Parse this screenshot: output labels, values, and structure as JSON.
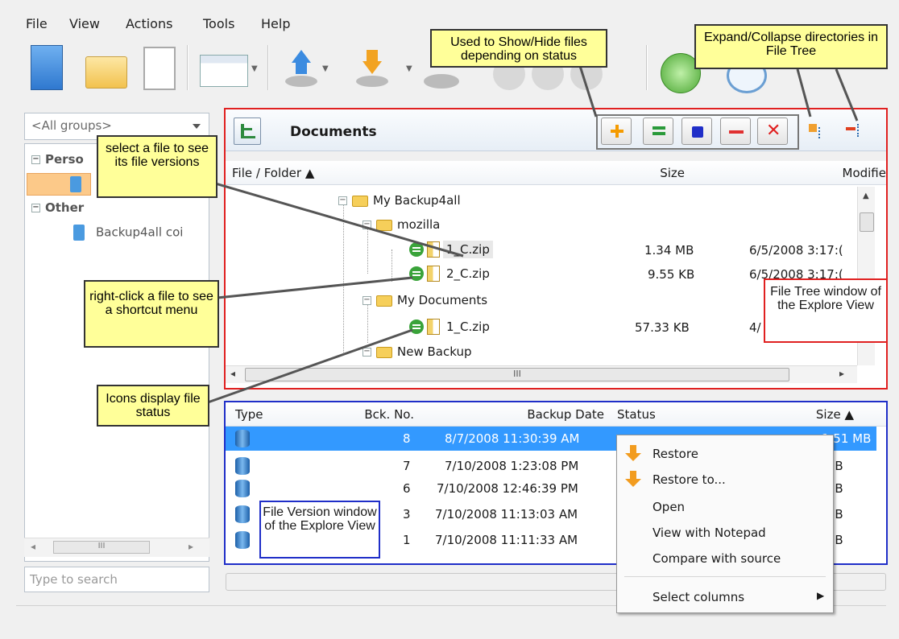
{
  "menu": [
    "File",
    "View",
    "Actions",
    "Tools",
    "Help"
  ],
  "left": {
    "group_select": "<All groups>",
    "tree": [
      {
        "label": "Perso",
        "type": "group"
      },
      {
        "label": "Other",
        "type": "group"
      },
      {
        "label": "Backup4all coi",
        "type": "item"
      }
    ],
    "scroll_glyph": "III",
    "search_placeholder": "Type to search"
  },
  "header": {
    "title": "Documents"
  },
  "file_tree": {
    "columns": [
      "File / Folder ▲",
      "Size",
      "Modifie"
    ],
    "rows": [
      {
        "label": "My Backup4all",
        "kind": "folder"
      },
      {
        "label": "mozilla",
        "kind": "folder"
      },
      {
        "label": "1_C.zip",
        "kind": "file",
        "size": "1.34 MB",
        "modified": "6/5/2008 3:17:("
      },
      {
        "label": "2_C.zip",
        "kind": "file",
        "size": "9.55 KB",
        "modified": "6/5/2008 3:17:("
      },
      {
        "label": "My Documents",
        "kind": "folder"
      },
      {
        "label": "1_C.zip",
        "kind": "file",
        "size": "57.33 KB",
        "modified": "4/"
      },
      {
        "label": "New Backup",
        "kind": "folder"
      }
    ],
    "hscroll_glyph": "III"
  },
  "versions": {
    "columns": [
      "Type",
      "Bck. No.",
      "Backup Date",
      "Status",
      "Size ▲"
    ],
    "rows": [
      {
        "no": "8",
        "date": "8/7/2008 11:30:39 AM",
        "size": "1.51 MB",
        "selected": true
      },
      {
        "no": "7",
        "date": "7/10/2008 1:23:08 PM",
        "size": "IB"
      },
      {
        "no": "6",
        "date": "7/10/2008 12:46:39 PM",
        "size": "IB"
      },
      {
        "no": "3",
        "date": "7/10/2008 11:13:03 AM",
        "size": "IB"
      },
      {
        "no": "1",
        "date": "7/10/2008 11:11:33 AM",
        "size": "IB"
      }
    ]
  },
  "context_menu": {
    "items": [
      "Restore",
      "Restore to...",
      "Open",
      "View with Notepad",
      "Compare with source"
    ],
    "submenu": "Select columns"
  },
  "callouts": {
    "show_hide": "Used to Show/Hide files depending on status",
    "expand_collapse": "Expand/Collapse directories in File Tree",
    "select_file": "select a file to see its file versions",
    "right_click": "right-click a file to see a shortcut menu",
    "icons_status": "Icons display file status",
    "file_version": "File Version window of the Explore View",
    "file_tree": "File Tree window of the Explore View"
  },
  "colors": {
    "accent_red": "#e02020",
    "accent_blue": "#1f2ec8",
    "selection": "#3399ff",
    "callout": "#ffff99"
  }
}
